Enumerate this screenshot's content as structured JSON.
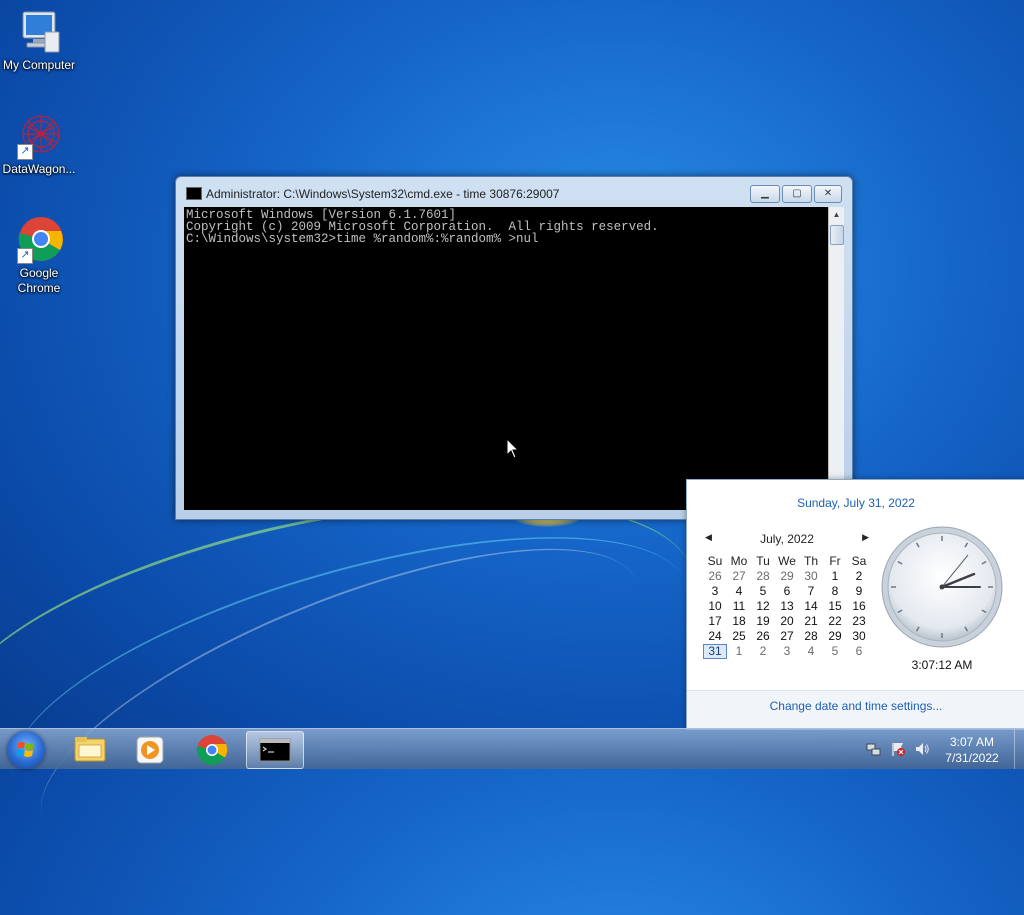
{
  "desktop": {
    "icons": [
      {
        "label": "My Computer"
      },
      {
        "label": "DataWagon..."
      },
      {
        "label": "Google Chrome"
      }
    ]
  },
  "cmd_window": {
    "title": "Administrator: C:\\Windows\\System32\\cmd.exe - time  30876:29007",
    "lines": [
      "Microsoft Windows [Version 6.1.7601]",
      "Copyright (c) 2009 Microsoft Corporation.  All rights reserved.",
      "",
      "C:\\Windows\\system32>time %random%:%random% >nul"
    ]
  },
  "calendar_flyout": {
    "long_date": "Sunday, July 31, 2022",
    "month_label": "July, 2022",
    "weekdays": [
      "Su",
      "Mo",
      "Tu",
      "We",
      "Th",
      "Fr",
      "Sa"
    ],
    "weeks": [
      [
        "26",
        "27",
        "28",
        "29",
        "30",
        "1",
        "2"
      ],
      [
        "3",
        "4",
        "5",
        "6",
        "7",
        "8",
        "9"
      ],
      [
        "10",
        "11",
        "12",
        "13",
        "14",
        "15",
        "16"
      ],
      [
        "17",
        "18",
        "19",
        "20",
        "21",
        "22",
        "23"
      ],
      [
        "24",
        "25",
        "26",
        "27",
        "28",
        "29",
        "30"
      ],
      [
        "31",
        "1",
        "2",
        "3",
        "4",
        "5",
        "6"
      ]
    ],
    "today": "31",
    "clock_time": "3:07:12 AM",
    "settings_link": "Change date and time settings..."
  },
  "taskbar": {
    "time": "3:07 AM",
    "date": "7/31/2022"
  }
}
